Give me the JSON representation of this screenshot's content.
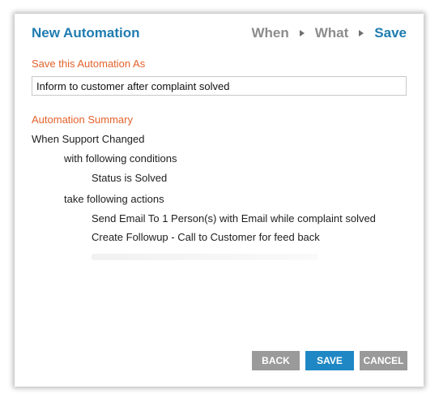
{
  "header": {
    "title": "New Automation",
    "steps": [
      {
        "label": "When",
        "active": false
      },
      {
        "label": "What",
        "active": false
      },
      {
        "label": "Save",
        "active": true
      }
    ]
  },
  "save_section": {
    "label": "Save this Automation As",
    "input_value": "Inform to customer after complaint solved"
  },
  "summary": {
    "label": "Automation Summary",
    "trigger": "When Support Changed",
    "conditions_heading": "with following conditions",
    "conditions": [
      "Status is Solved"
    ],
    "actions_heading": "take following actions",
    "actions": [
      "Send Email To 1 Person(s) with Email while complaint solved",
      "Create Followup - Call to Customer for feed back"
    ]
  },
  "buttons": {
    "back": "BACK",
    "save": "SAVE",
    "cancel": "CANCEL"
  },
  "colors": {
    "accent_blue": "#1f7cb0",
    "label_orange": "#e2622b",
    "step_gray": "#8c8c8c",
    "button_gray": "#9a9a9a",
    "button_blue": "#1f88c4"
  }
}
